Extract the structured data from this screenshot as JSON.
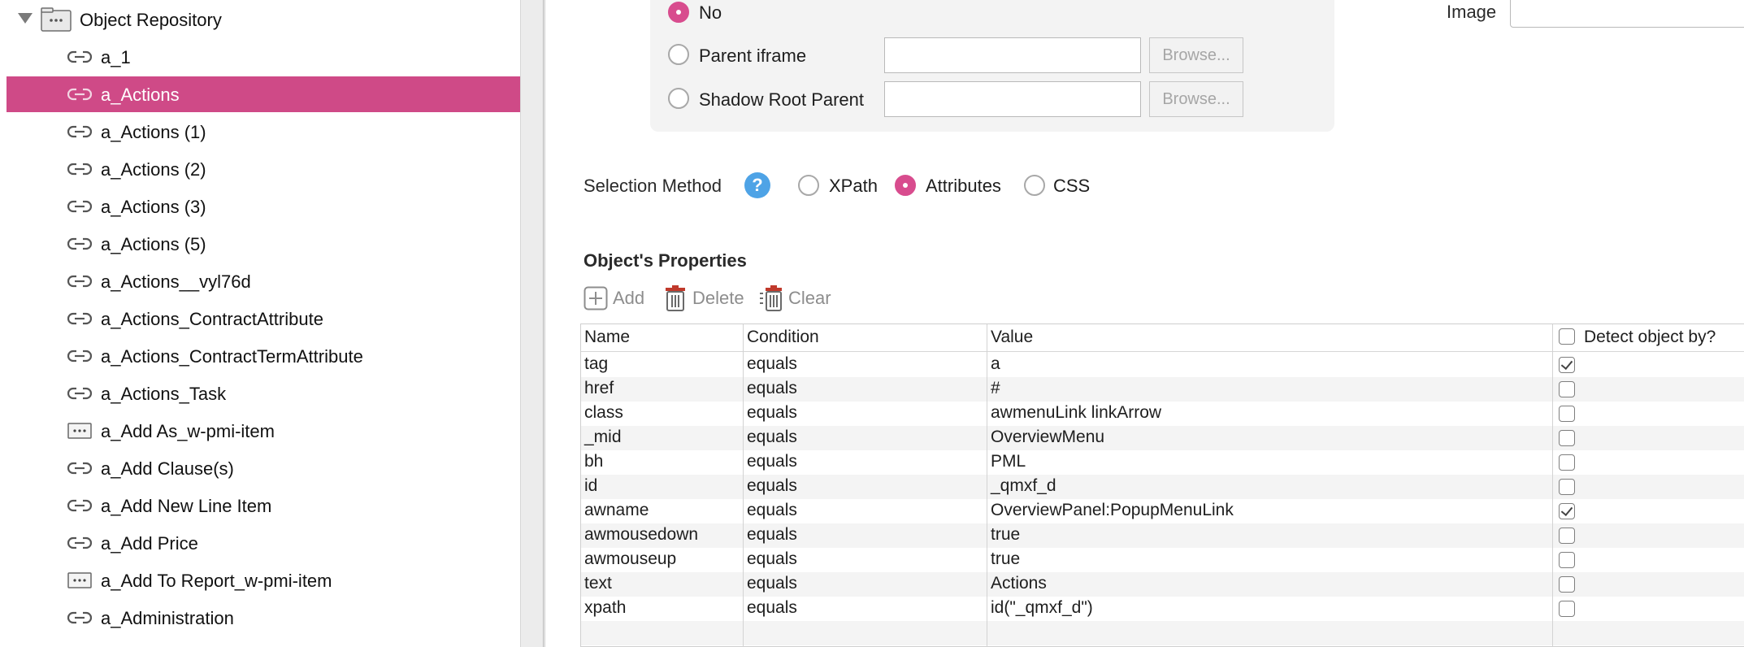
{
  "tree": {
    "root_label": "Object Repository",
    "items": [
      {
        "label": "a_1",
        "icon": "link-icon",
        "selected": false
      },
      {
        "label": "a_Actions",
        "icon": "link-icon",
        "selected": true
      },
      {
        "label": "a_Actions (1)",
        "icon": "link-icon",
        "selected": false
      },
      {
        "label": "a_Actions (2)",
        "icon": "link-icon",
        "selected": false
      },
      {
        "label": "a_Actions (3)",
        "icon": "link-icon",
        "selected": false
      },
      {
        "label": "a_Actions (5)",
        "icon": "link-icon",
        "selected": false
      },
      {
        "label": "a_Actions__vyl76d",
        "icon": "link-icon",
        "selected": false
      },
      {
        "label": "a_Actions_ContractAttribute",
        "icon": "link-icon",
        "selected": false
      },
      {
        "label": "a_Actions_ContractTermAttribute",
        "icon": "link-icon",
        "selected": false
      },
      {
        "label": "a_Actions_Task",
        "icon": "link-icon",
        "selected": false
      },
      {
        "label": "a_Add As_w-pmi-item",
        "icon": "element-box-icon",
        "selected": false
      },
      {
        "label": "a_Add Clause(s)",
        "icon": "link-icon",
        "selected": false
      },
      {
        "label": "a_Add New Line Item",
        "icon": "link-icon",
        "selected": false
      },
      {
        "label": "a_Add Price",
        "icon": "link-icon",
        "selected": false
      },
      {
        "label": "a_Add To Report_w-pmi-item",
        "icon": "element-box-icon",
        "selected": false
      },
      {
        "label": "a_Administration",
        "icon": "link-icon",
        "selected": false
      }
    ]
  },
  "frame": {
    "no_label": "No",
    "parent_iframe_label": "Parent iframe",
    "shadow_root_label": "Shadow Root Parent",
    "browse_label": "Browse...",
    "parent_iframe_value": "",
    "shadow_root_value": "",
    "selected": "No"
  },
  "image": {
    "label": "Image",
    "value": ""
  },
  "selection": {
    "label": "Selection Method",
    "options": [
      "XPath",
      "Attributes",
      "CSS"
    ],
    "selected": "Attributes"
  },
  "properties": {
    "title": "Object's Properties",
    "toolbar": {
      "add": "Add",
      "delete": "Delete",
      "clear": "Clear"
    },
    "columns": {
      "name": "Name",
      "condition": "Condition",
      "value": "Value",
      "detect": "Detect object by?"
    },
    "detect_all_checked": false,
    "rows": [
      {
        "name": "tag",
        "condition": "equals",
        "value": "a",
        "detect": true
      },
      {
        "name": "href",
        "condition": "equals",
        "value": "#",
        "detect": false
      },
      {
        "name": "class",
        "condition": "equals",
        "value": "awmenuLink linkArrow",
        "detect": false
      },
      {
        "name": "_mid",
        "condition": "equals",
        "value": "OverviewMenu",
        "detect": false
      },
      {
        "name": "bh",
        "condition": "equals",
        "value": "PML",
        "detect": false
      },
      {
        "name": "id",
        "condition": "equals",
        "value": "_qmxf_d",
        "detect": false
      },
      {
        "name": "awname",
        "condition": "equals",
        "value": "OverviewPanel:PopupMenuLink",
        "detect": true
      },
      {
        "name": "awmousedown",
        "condition": "equals",
        "value": "true",
        "detect": false
      },
      {
        "name": "awmouseup",
        "condition": "equals",
        "value": "true",
        "detect": false
      },
      {
        "name": "text",
        "condition": "equals",
        "value": "Actions",
        "detect": false
      },
      {
        "name": "xpath",
        "condition": "equals",
        "value": "id(\"_qmxf_d\")",
        "detect": false
      }
    ]
  },
  "colors": {
    "accent": "#d84c8e",
    "selected_row": "#cf4a87",
    "help": "#4ea3e6"
  }
}
